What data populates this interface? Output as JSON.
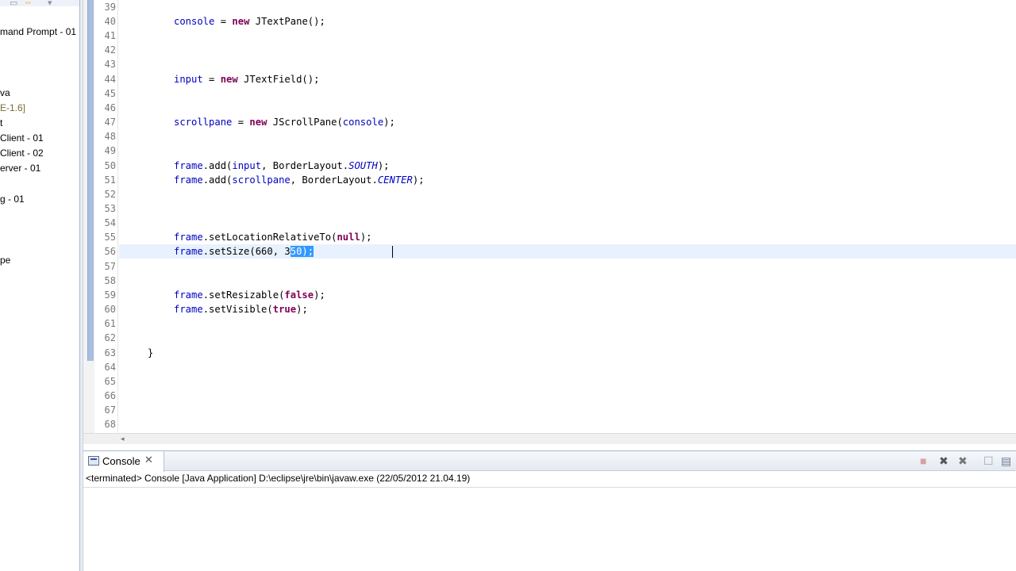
{
  "explorer": {
    "items": [
      {
        "label": "mand Prompt - 01",
        "dim": false
      },
      {
        "label": "va",
        "dim": false
      },
      {
        "label": "E-1.6]",
        "dim": true
      },
      {
        "label": "t",
        "dim": false
      },
      {
        "label": "Client - 01",
        "dim": false
      },
      {
        "label": "Client - 02",
        "dim": false
      },
      {
        "label": "erver - 01",
        "dim": false
      },
      {
        "label": "g - 01",
        "dim": false
      },
      {
        "label": "pe",
        "dim": false
      }
    ]
  },
  "editor": {
    "lines": [
      {
        "n": "39",
        "code": ""
      },
      {
        "n": "40",
        "code": "console = new JTextPane();"
      },
      {
        "n": "41",
        "code": ""
      },
      {
        "n": "42",
        "code": ""
      },
      {
        "n": "43",
        "code": ""
      },
      {
        "n": "44",
        "code": "input = new JTextField();"
      },
      {
        "n": "45",
        "code": ""
      },
      {
        "n": "46",
        "code": ""
      },
      {
        "n": "47",
        "code": "scrollpane = new JScrollPane(console);"
      },
      {
        "n": "48",
        "code": ""
      },
      {
        "n": "49",
        "code": ""
      },
      {
        "n": "50",
        "code": "frame.add(input, BorderLayout.SOUTH);"
      },
      {
        "n": "51",
        "code": "frame.add(scrollpane, BorderLayout.CENTER);"
      },
      {
        "n": "52",
        "code": ""
      },
      {
        "n": "53",
        "code": ""
      },
      {
        "n": "54",
        "code": ""
      },
      {
        "n": "55",
        "code": "frame.setLocationRelativeTo(null);"
      },
      {
        "n": "56",
        "code": "frame.setSize(660, 350);"
      },
      {
        "n": "57",
        "code": ""
      },
      {
        "n": "58",
        "code": ""
      },
      {
        "n": "59",
        "code": "frame.setResizable(false);"
      },
      {
        "n": "60",
        "code": "frame.setVisible(true);"
      },
      {
        "n": "61",
        "code": ""
      },
      {
        "n": "62",
        "code": ""
      },
      {
        "n": "63",
        "code": "}"
      },
      {
        "n": "64",
        "code": ""
      },
      {
        "n": "65",
        "code": ""
      },
      {
        "n": "66",
        "code": ""
      },
      {
        "n": "67",
        "code": ""
      },
      {
        "n": "68",
        "code": ""
      }
    ],
    "tokens": {
      "console": "console",
      "new": "new",
      "JTextPane": " JTextPane();",
      "input": "input",
      "JTextField": " JTextField();",
      "scrollpane": "scrollpane",
      "JScrollPane": " JScrollPane(",
      "console_arg": "console",
      "close_paren": ");",
      "frame": "frame",
      "add_open": ".add(",
      "comma_border": ", BorderLayout.",
      "SOUTH": "SOUTH",
      "CENTER": "CENTER",
      "set_location": ".setLocationRelativeTo(",
      "null": "null",
      "set_size_prefix": ".setSize(660, 3",
      "selected": "50);",
      "set_resizable": ".setResizable(",
      "false": "false",
      "set_visible": ".setVisible(",
      "true": "true",
      "assign": " = ",
      "brace": "}"
    }
  },
  "console": {
    "tab_label": "Console",
    "close_glyph": "✕",
    "status": "<terminated> Console [Java Application] D:\\eclipse\\jre\\bin\\javaw.exe (22/05/2012 21.04.19)",
    "buttons": [
      {
        "name": "terminate-icon",
        "glyph": "■",
        "color": "#d9a0a0"
      },
      {
        "name": "remove-launch-icon",
        "glyph": "✖",
        "color": "#555555"
      },
      {
        "name": "remove-all-terminated-icon",
        "glyph": "✖",
        "color": "#777777"
      },
      {
        "name": "clear-console-icon",
        "glyph": "☐",
        "color": "#9aa6b8"
      },
      {
        "name": "scroll-lock-icon",
        "glyph": "▤",
        "color": "#6b7a92"
      }
    ]
  }
}
